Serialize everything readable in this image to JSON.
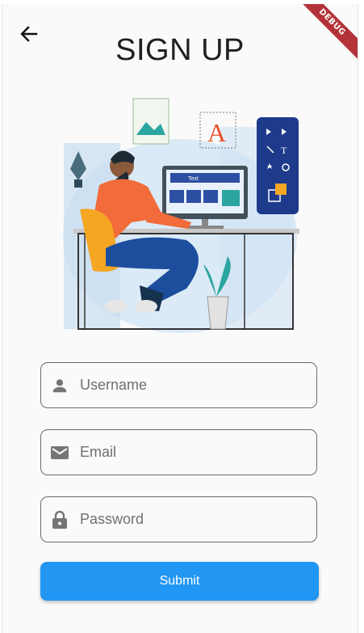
{
  "header": {
    "title": "SIGN UP",
    "back_icon": "arrow-back-icon",
    "debug_label": "DEBUG"
  },
  "illustration": {
    "canvas_letter": "A",
    "screen_text": "Text"
  },
  "form": {
    "username": {
      "placeholder": "Username",
      "icon": "person-icon"
    },
    "email": {
      "placeholder": "Email",
      "icon": "mail-icon"
    },
    "password": {
      "placeholder": "Password",
      "icon": "lock-icon"
    },
    "submit_label": "Submit"
  },
  "colors": {
    "primary": "#2196f3",
    "ribbon": "#b4333a",
    "background": "#fafafa",
    "icon_gray": "#757575"
  }
}
